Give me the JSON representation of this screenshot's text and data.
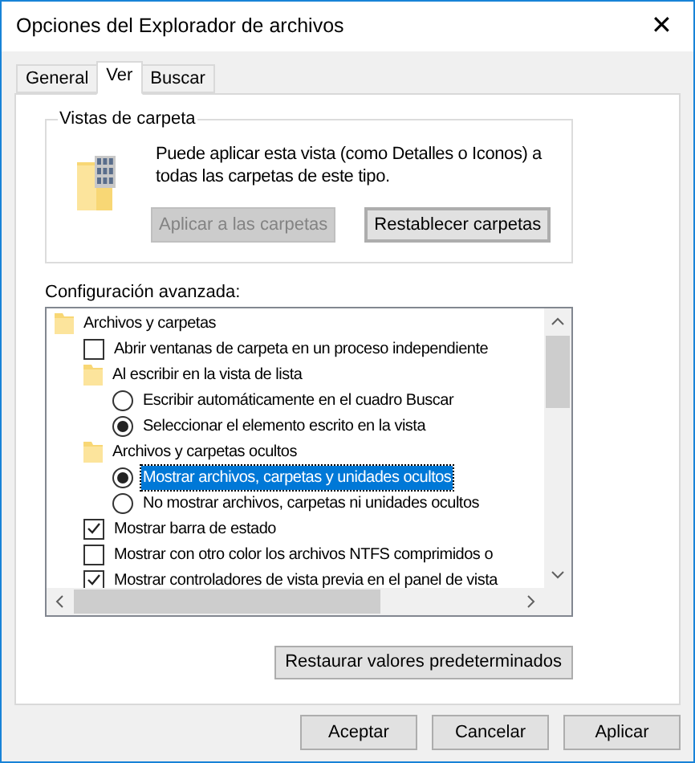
{
  "window": {
    "title": "Opciones del Explorador de archivos",
    "close": "✕"
  },
  "tabs": [
    {
      "label": "General",
      "selected": false
    },
    {
      "label": "Ver",
      "selected": true
    },
    {
      "label": "Buscar",
      "selected": false
    }
  ],
  "folder_views": {
    "title": "Vistas de carpeta",
    "description": "Puede aplicar esta vista (como Detalles o Iconos) a todas las carpetas de este tipo.",
    "buttons": [
      {
        "label": "Aplicar a las carpetas",
        "disabled": true,
        "focused": false
      },
      {
        "label": "Restablecer carpetas",
        "disabled": false,
        "focused": true
      }
    ]
  },
  "advanced": {
    "label": "Configuración avanzada:",
    "tree": [
      {
        "kind": "folder",
        "label": "Archivos y carpetas",
        "selected": false,
        "children": [
          {
            "kind": "checkbox",
            "label": "Abrir ventanas de carpeta  en un proceso independiente",
            "checked": false,
            "selected": false
          },
          {
            "kind": "folder",
            "label": "Al escribir en la vista de lista",
            "selected": false,
            "children": [
              {
                "kind": "radio",
                "label": "Escribir automáticamente en el cuadro Buscar",
                "checked": false,
                "selected": false
              },
              {
                "kind": "radio",
                "label": "Seleccionar el elemento escrito en la vista",
                "checked": true,
                "selected": false
              }
            ]
          },
          {
            "kind": "folder",
            "label": "Archivos y carpetas ocultos",
            "selected": false,
            "children": [
              {
                "kind": "radio",
                "label": "Mostrar archivos, carpetas y unidades ocultos",
                "checked": true,
                "selected": true
              },
              {
                "kind": "radio",
                "label": "No mostrar archivos, carpetas ni unidades ocultos",
                "checked": false,
                "selected": false
              }
            ]
          },
          {
            "kind": "checkbox",
            "label": "Mostrar barra de estado",
            "checked": true,
            "selected": false
          },
          {
            "kind": "checkbox",
            "label": "Mostrar con otro color los archivos NTFS comprimidos o",
            "checked": false,
            "selected": false
          },
          {
            "kind": "checkbox",
            "label": "Mostrar controladores de vista previa en el panel de vista",
            "checked": true,
            "selected": false
          }
        ]
      }
    ],
    "restore_button": "Restaurar valores predeterminados"
  },
  "buttons": [
    {
      "label": "Aceptar"
    },
    {
      "label": "Cancelar"
    },
    {
      "label": "Aplicar"
    }
  ]
}
